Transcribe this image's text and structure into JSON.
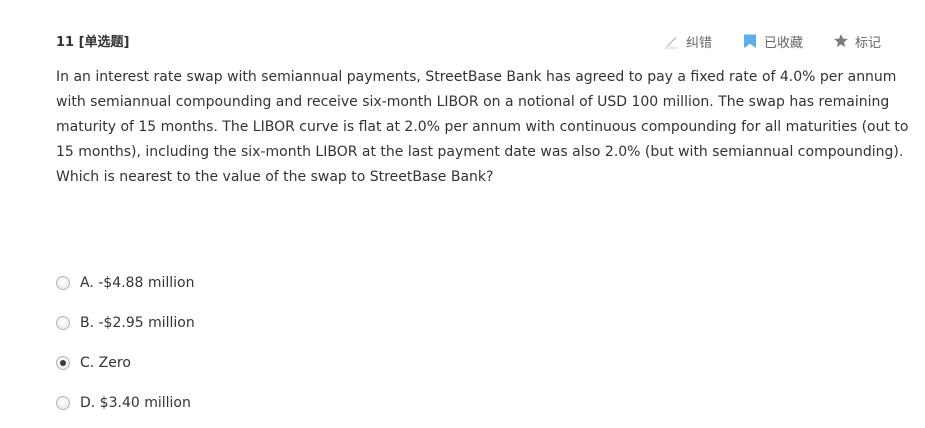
{
  "question": {
    "number_label": "11 [单选题]",
    "text": "In an interest rate swap with semiannual payments, StreetBase Bank has agreed to pay a fixed rate of 4.0% per annum with semiannual compounding and receive six-month LIBOR on a notional of USD 100 million. The swap has remaining maturity of 15 months. The LIBOR curve is flat at 2.0% per annum with continuous compounding for all maturities (out to 15 months), including the six-month LIBOR at the last payment date was also 2.0% (but with semiannual compounding). Which is nearest to the value of the swap to StreetBase Bank?"
  },
  "toolbar": {
    "report_label": "纠错",
    "report_icon": "pencil-icon",
    "favorite_label": "已收藏",
    "favorite_icon": "bookmark-icon",
    "favorite_color": "#5bb0e8",
    "mark_label": "标记",
    "mark_icon": "star-icon"
  },
  "options": [
    {
      "label": "A. -$4.88 million",
      "selected": false
    },
    {
      "label": "B. -$2.95 million",
      "selected": false
    },
    {
      "label": "C. Zero",
      "selected": true
    },
    {
      "label": "D. $3.40 million",
      "selected": false
    }
  ]
}
